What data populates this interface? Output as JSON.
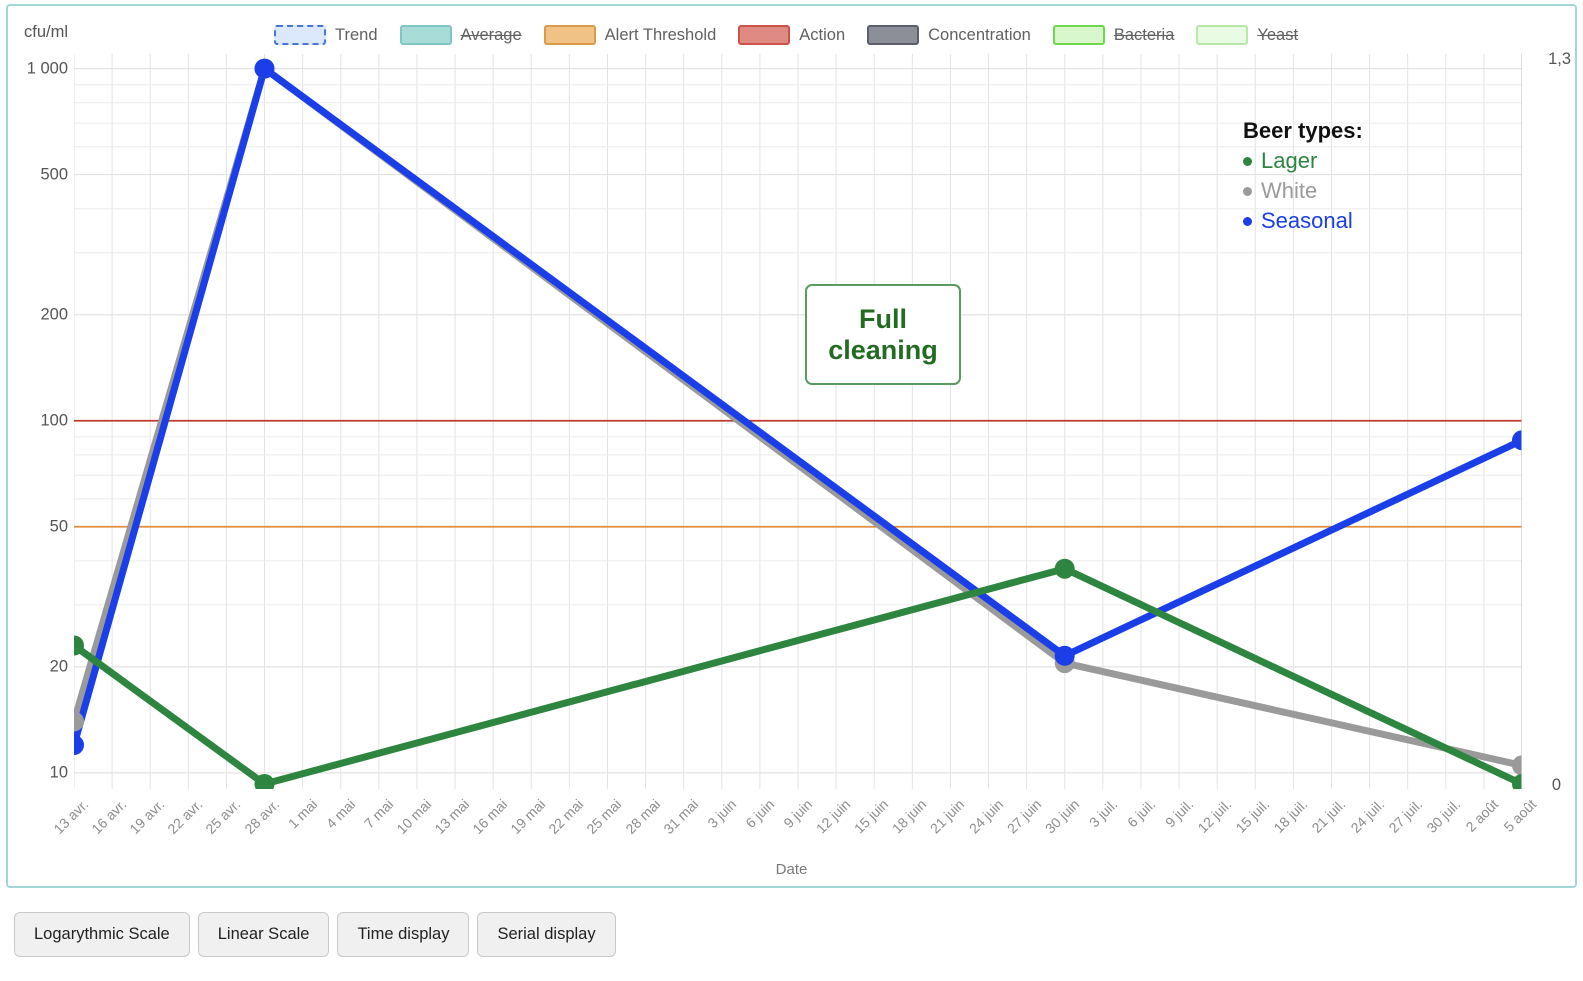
{
  "chart_data": {
    "type": "line",
    "title": "",
    "xlabel": "Date",
    "ylabel": "cfu/ml",
    "y_unit": "cfu/ml",
    "yscale": "log",
    "ylim": [
      9,
      1100
    ],
    "y_ticks": [
      1000,
      500,
      200,
      100,
      50,
      20,
      10
    ],
    "y_tick_labels": [
      "1 000",
      "500",
      "200",
      "100",
      "50",
      "20",
      "10"
    ],
    "y2_top_label": "1,3",
    "y2_bottom_label": "0",
    "grid": true,
    "legend_position": "top",
    "x_start": "13 avr.",
    "x_end": "5 aout",
    "categories": [
      "13 avr.",
      "16 avr.",
      "19 avr.",
      "22 avr.",
      "25 avr.",
      "28 avr.",
      "1 mai",
      "4 mai",
      "7 mai",
      "10 mai",
      "13 mai",
      "16 mai",
      "19 mai",
      "22 mai",
      "25 mai",
      "28 mai",
      "31 mai",
      "3 juin",
      "6 juin",
      "9 juin",
      "12 juin",
      "15 juin",
      "18 juin",
      "21 juin",
      "24 juin",
      "27 juin",
      "30 juin",
      "3 juil.",
      "6 juil.",
      "9 juil.",
      "12 juil.",
      "15 juil.",
      "18 juil.",
      "21 juil.",
      "24 juil.",
      "27 juil.",
      "30 juil.",
      "2 août",
      "5 août"
    ],
    "series": [
      {
        "name": "Lager",
        "color": "#2e8540",
        "points": [
          {
            "x": "13 avr.",
            "y": 23
          },
          {
            "x": "28 avr.",
            "y": 9.3
          },
          {
            "x": "30 juin",
            "y": 38
          },
          {
            "x": "5 août",
            "y": 9.3
          }
        ]
      },
      {
        "name": "White",
        "color": "#9a9a9a",
        "points": [
          {
            "x": "13 avr.",
            "y": 14
          },
          {
            "x": "28 avr.",
            "y": 1000
          },
          {
            "x": "30 juin",
            "y": 20.5
          },
          {
            "x": "5 août",
            "y": 10.5
          }
        ]
      },
      {
        "name": "Seasonal",
        "color": "#1a3ee8",
        "points": [
          {
            "x": "13 avr.",
            "y": 12
          },
          {
            "x": "28 avr.",
            "y": 1000
          },
          {
            "x": "30 juin",
            "y": 21.5
          },
          {
            "x": "5 août",
            "y": 88
          }
        ]
      }
    ],
    "threshold_lines": [
      {
        "name": "Action",
        "value": 100,
        "color": "#c0392b"
      },
      {
        "name": "Alert Threshold",
        "value": 50,
        "color": "#e08d3c"
      }
    ],
    "annotations": [
      {
        "label": "Full cleaning",
        "x": "16 juin",
        "color": "#236b23"
      }
    ]
  },
  "legend": {
    "items": [
      {
        "label": "Trend",
        "fill": "#dce8fb",
        "stroke": "#4a76d4",
        "dashed": true,
        "disabled": false
      },
      {
        "label": "Average",
        "fill": "#a8dcd8",
        "stroke": "#7fc7c2",
        "dashed": false,
        "disabled": true
      },
      {
        "label": "Alert Threshold",
        "fill": "#f0c286",
        "stroke": "#d99a4a",
        "dashed": false,
        "disabled": false
      },
      {
        "label": "Action",
        "fill": "#e08a84",
        "stroke": "#cc524a",
        "dashed": false,
        "disabled": false
      },
      {
        "label": "Concentration",
        "fill": "#8d8f98",
        "stroke": "#5c5f6b",
        "dashed": false,
        "disabled": false
      },
      {
        "label": "Bacteria",
        "fill": "#d9f7cd",
        "stroke": "#6fd84a",
        "dashed": false,
        "disabled": true
      },
      {
        "label": "Yeast",
        "fill": "#eafbe4",
        "stroke": "#b6e8a8",
        "dashed": false,
        "disabled": true
      }
    ]
  },
  "beer_types": {
    "title": "Beer types:",
    "items": [
      {
        "label": "Lager",
        "color": "#2e8540"
      },
      {
        "label": "White",
        "color": "#9a9a9a"
      },
      {
        "label": "Seasonal",
        "color": "#1a3ee8"
      }
    ]
  },
  "annotation": {
    "line1": "Full",
    "line2": "cleaning",
    "text": "Full cleaning",
    "color": "#236b23"
  },
  "buttons": [
    {
      "label": "Logarythmic Scale"
    },
    {
      "label": "Linear Scale"
    },
    {
      "label": "Time display"
    },
    {
      "label": "Serial display"
    }
  ],
  "colors": {
    "card_border": "#9fd8d4",
    "grid": "#e3e3e3",
    "axis_text": "#555555",
    "tick_text": "#8d8d8d"
  }
}
